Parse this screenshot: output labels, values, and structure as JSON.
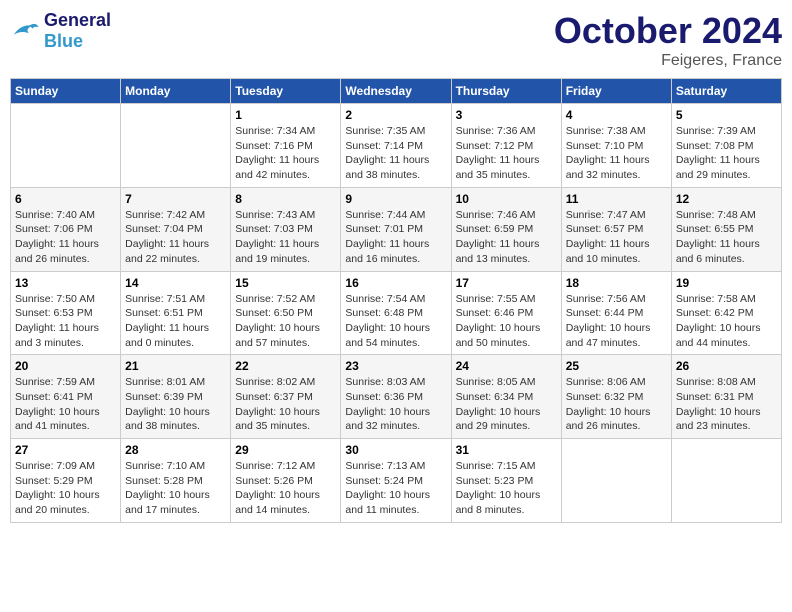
{
  "header": {
    "logo_general": "General",
    "logo_blue": "Blue",
    "month": "October 2024",
    "location": "Feigeres, France"
  },
  "weekdays": [
    "Sunday",
    "Monday",
    "Tuesday",
    "Wednesday",
    "Thursday",
    "Friday",
    "Saturday"
  ],
  "weeks": [
    [
      {
        "day": "",
        "info": ""
      },
      {
        "day": "",
        "info": ""
      },
      {
        "day": "1",
        "info": "Sunrise: 7:34 AM\nSunset: 7:16 PM\nDaylight: 11 hours\nand 42 minutes."
      },
      {
        "day": "2",
        "info": "Sunrise: 7:35 AM\nSunset: 7:14 PM\nDaylight: 11 hours\nand 38 minutes."
      },
      {
        "day": "3",
        "info": "Sunrise: 7:36 AM\nSunset: 7:12 PM\nDaylight: 11 hours\nand 35 minutes."
      },
      {
        "day": "4",
        "info": "Sunrise: 7:38 AM\nSunset: 7:10 PM\nDaylight: 11 hours\nand 32 minutes."
      },
      {
        "day": "5",
        "info": "Sunrise: 7:39 AM\nSunset: 7:08 PM\nDaylight: 11 hours\nand 29 minutes."
      }
    ],
    [
      {
        "day": "6",
        "info": "Sunrise: 7:40 AM\nSunset: 7:06 PM\nDaylight: 11 hours\nand 26 minutes."
      },
      {
        "day": "7",
        "info": "Sunrise: 7:42 AM\nSunset: 7:04 PM\nDaylight: 11 hours\nand 22 minutes."
      },
      {
        "day": "8",
        "info": "Sunrise: 7:43 AM\nSunset: 7:03 PM\nDaylight: 11 hours\nand 19 minutes."
      },
      {
        "day": "9",
        "info": "Sunrise: 7:44 AM\nSunset: 7:01 PM\nDaylight: 11 hours\nand 16 minutes."
      },
      {
        "day": "10",
        "info": "Sunrise: 7:46 AM\nSunset: 6:59 PM\nDaylight: 11 hours\nand 13 minutes."
      },
      {
        "day": "11",
        "info": "Sunrise: 7:47 AM\nSunset: 6:57 PM\nDaylight: 11 hours\nand 10 minutes."
      },
      {
        "day": "12",
        "info": "Sunrise: 7:48 AM\nSunset: 6:55 PM\nDaylight: 11 hours\nand 6 minutes."
      }
    ],
    [
      {
        "day": "13",
        "info": "Sunrise: 7:50 AM\nSunset: 6:53 PM\nDaylight: 11 hours\nand 3 minutes."
      },
      {
        "day": "14",
        "info": "Sunrise: 7:51 AM\nSunset: 6:51 PM\nDaylight: 11 hours\nand 0 minutes."
      },
      {
        "day": "15",
        "info": "Sunrise: 7:52 AM\nSunset: 6:50 PM\nDaylight: 10 hours\nand 57 minutes."
      },
      {
        "day": "16",
        "info": "Sunrise: 7:54 AM\nSunset: 6:48 PM\nDaylight: 10 hours\nand 54 minutes."
      },
      {
        "day": "17",
        "info": "Sunrise: 7:55 AM\nSunset: 6:46 PM\nDaylight: 10 hours\nand 50 minutes."
      },
      {
        "day": "18",
        "info": "Sunrise: 7:56 AM\nSunset: 6:44 PM\nDaylight: 10 hours\nand 47 minutes."
      },
      {
        "day": "19",
        "info": "Sunrise: 7:58 AM\nSunset: 6:42 PM\nDaylight: 10 hours\nand 44 minutes."
      }
    ],
    [
      {
        "day": "20",
        "info": "Sunrise: 7:59 AM\nSunset: 6:41 PM\nDaylight: 10 hours\nand 41 minutes."
      },
      {
        "day": "21",
        "info": "Sunrise: 8:01 AM\nSunset: 6:39 PM\nDaylight: 10 hours\nand 38 minutes."
      },
      {
        "day": "22",
        "info": "Sunrise: 8:02 AM\nSunset: 6:37 PM\nDaylight: 10 hours\nand 35 minutes."
      },
      {
        "day": "23",
        "info": "Sunrise: 8:03 AM\nSunset: 6:36 PM\nDaylight: 10 hours\nand 32 minutes."
      },
      {
        "day": "24",
        "info": "Sunrise: 8:05 AM\nSunset: 6:34 PM\nDaylight: 10 hours\nand 29 minutes."
      },
      {
        "day": "25",
        "info": "Sunrise: 8:06 AM\nSunset: 6:32 PM\nDaylight: 10 hours\nand 26 minutes."
      },
      {
        "day": "26",
        "info": "Sunrise: 8:08 AM\nSunset: 6:31 PM\nDaylight: 10 hours\nand 23 minutes."
      }
    ],
    [
      {
        "day": "27",
        "info": "Sunrise: 7:09 AM\nSunset: 5:29 PM\nDaylight: 10 hours\nand 20 minutes."
      },
      {
        "day": "28",
        "info": "Sunrise: 7:10 AM\nSunset: 5:28 PM\nDaylight: 10 hours\nand 17 minutes."
      },
      {
        "day": "29",
        "info": "Sunrise: 7:12 AM\nSunset: 5:26 PM\nDaylight: 10 hours\nand 14 minutes."
      },
      {
        "day": "30",
        "info": "Sunrise: 7:13 AM\nSunset: 5:24 PM\nDaylight: 10 hours\nand 11 minutes."
      },
      {
        "day": "31",
        "info": "Sunrise: 7:15 AM\nSunset: 5:23 PM\nDaylight: 10 hours\nand 8 minutes."
      },
      {
        "day": "",
        "info": ""
      },
      {
        "day": "",
        "info": ""
      }
    ]
  ]
}
